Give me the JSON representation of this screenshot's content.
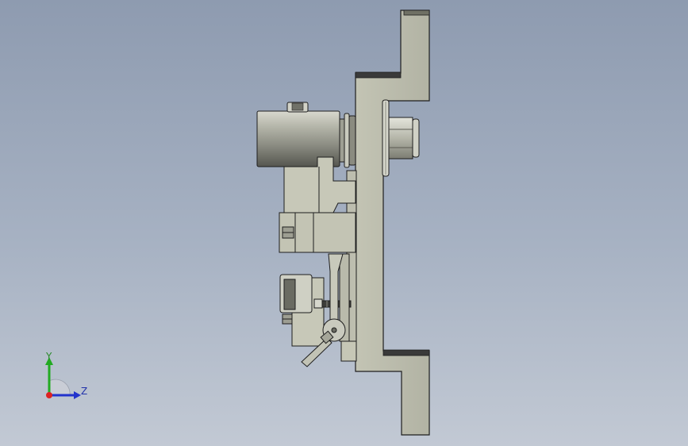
{
  "viewport": {
    "background_top": "#8e9bb0",
    "background_bottom": "#c2c9d4"
  },
  "model": {
    "part_color": "#c6c7b6",
    "part_shadow": "#9fa091",
    "cylinder_dark": "#5c5d56",
    "edge_color": "#1e1e1e",
    "flange_dark": "#3a3a3a"
  },
  "triad": {
    "y_label": "Y",
    "z_label": "Z",
    "y_color": "#22aa22",
    "z_color": "#2233cc",
    "x_color": "#dd2222",
    "icons": [
      "axis-triad-icon",
      "origin-dot-icon"
    ]
  }
}
